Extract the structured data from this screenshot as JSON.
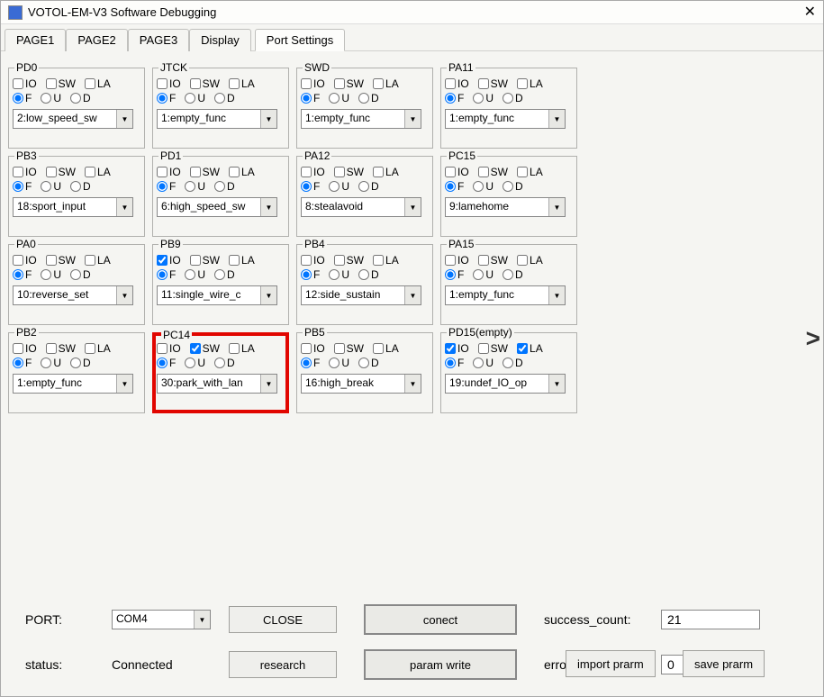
{
  "window": {
    "title": "VOTOL-EM-V3 Software Debugging"
  },
  "tabs": [
    "PAGE1",
    "PAGE2",
    "PAGE3",
    "Display",
    "Port Settings"
  ],
  "active_tab": 4,
  "labels": {
    "IO": "IO",
    "SW": "SW",
    "LA": "LA",
    "F": "F",
    "U": "U",
    "D": "D"
  },
  "ports": [
    {
      "name": "PD0",
      "io": false,
      "sw": false,
      "la": false,
      "rad": "F",
      "combo": "2:low_speed_sw"
    },
    {
      "name": "JTCK",
      "io": false,
      "sw": false,
      "la": false,
      "rad": "F",
      "combo": "1:empty_func"
    },
    {
      "name": "SWD",
      "io": false,
      "sw": false,
      "la": false,
      "rad": "F",
      "combo": "1:empty_func"
    },
    {
      "name": "PA11",
      "io": false,
      "sw": false,
      "la": false,
      "rad": "F",
      "combo": "1:empty_func"
    },
    {
      "name": "PB3",
      "io": false,
      "sw": false,
      "la": false,
      "rad": "F",
      "combo": "18:sport_input"
    },
    {
      "name": "PD1",
      "io": false,
      "sw": false,
      "la": false,
      "rad": "F",
      "combo": "6:high_speed_sw"
    },
    {
      "name": "PA12",
      "io": false,
      "sw": false,
      "la": false,
      "rad": "F",
      "combo": "8:stealavoid"
    },
    {
      "name": "PC15",
      "io": false,
      "sw": false,
      "la": false,
      "rad": "F",
      "combo": "9:lamehome"
    },
    {
      "name": "PA0",
      "io": false,
      "sw": false,
      "la": false,
      "rad": "F",
      "combo": "10:reverse_set"
    },
    {
      "name": "PB9",
      "io": true,
      "sw": false,
      "la": false,
      "rad": "F",
      "combo": "11:single_wire_c"
    },
    {
      "name": "PB4",
      "io": false,
      "sw": false,
      "la": false,
      "rad": "F",
      "combo": "12:side_sustain"
    },
    {
      "name": "PA15",
      "io": false,
      "sw": false,
      "la": false,
      "rad": "F",
      "combo": "1:empty_func"
    },
    {
      "name": "PB2",
      "io": false,
      "sw": false,
      "la": false,
      "rad": "F",
      "combo": "1:empty_func"
    },
    {
      "name": "PC14",
      "io": false,
      "sw": true,
      "la": false,
      "rad": "F",
      "combo": "30:park_with_lan",
      "highlight": true
    },
    {
      "name": "PB5",
      "io": false,
      "sw": false,
      "la": false,
      "rad": "F",
      "combo": "16:high_break"
    },
    {
      "name": "PD15(empty)",
      "io": true,
      "sw": false,
      "la": true,
      "rad": "F",
      "combo": "19:undef_IO_op"
    }
  ],
  "bottom": {
    "port_label": "PORT:",
    "port_value": "COM4",
    "close_btn": "CLOSE",
    "conect_btn": "conect",
    "success_label": "success_count:",
    "success_value": "21",
    "status_label": "status:",
    "status_value": "Connected",
    "research_btn": "research",
    "paramwrite_btn": "param write",
    "error_label": "error_count:",
    "error_value": "0",
    "import_btn": "import prarm",
    "save_btn": "save prarm"
  },
  "nav_right": ">"
}
